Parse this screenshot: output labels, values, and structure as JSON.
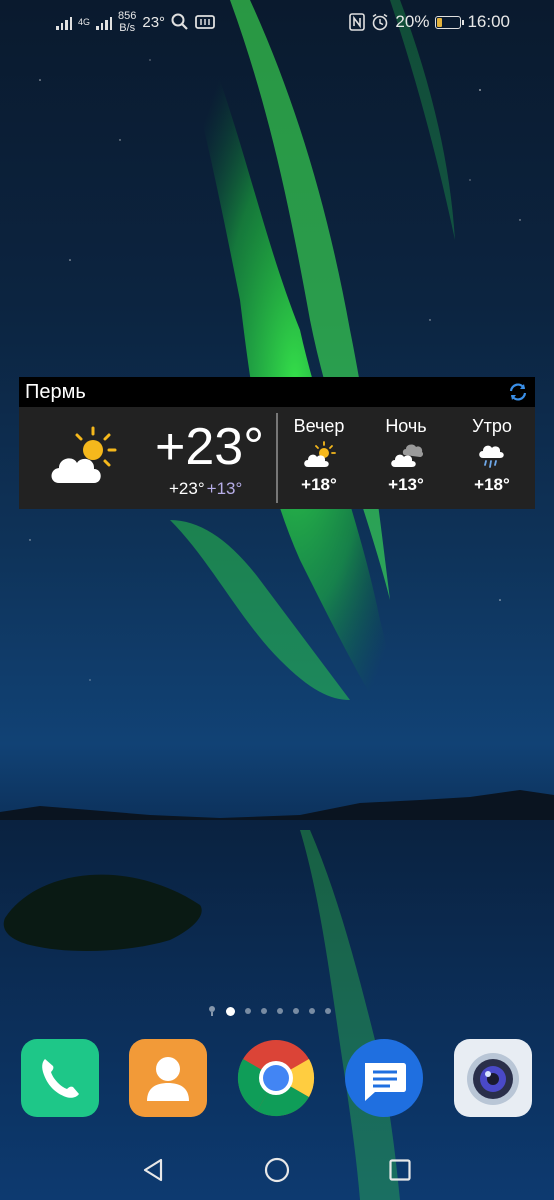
{
  "status_bar": {
    "network_type": "4G",
    "speed_value": "856",
    "speed_unit": "B/s",
    "weather_temp": "23°",
    "battery_percent": "20%",
    "battery_level": 0.2,
    "time": "16:00"
  },
  "weather_widget": {
    "city": "Пермь",
    "current_temp": "+23°",
    "high": "+23°",
    "low": "+13°",
    "forecast": [
      {
        "label": "Вечер",
        "temp": "+18°",
        "icon": "partly-sunny-icon"
      },
      {
        "label": "Ночь",
        "temp": "+13°",
        "icon": "cloudy-night-icon"
      },
      {
        "label": "Утро",
        "temp": "+18°",
        "icon": "rain-icon"
      }
    ],
    "colors": {
      "header_bg": "#000000",
      "body_bg": "#222222",
      "low_temp": "#b7aee8",
      "refresh": "#3a8fe8"
    }
  },
  "home": {
    "page_count": 8,
    "active_page": 2
  },
  "dock": {
    "apps": [
      "phone-app",
      "contacts-app",
      "chrome-app",
      "messages-app",
      "camera-app"
    ]
  },
  "navigation": {
    "buttons": [
      "back",
      "home",
      "recents"
    ]
  }
}
